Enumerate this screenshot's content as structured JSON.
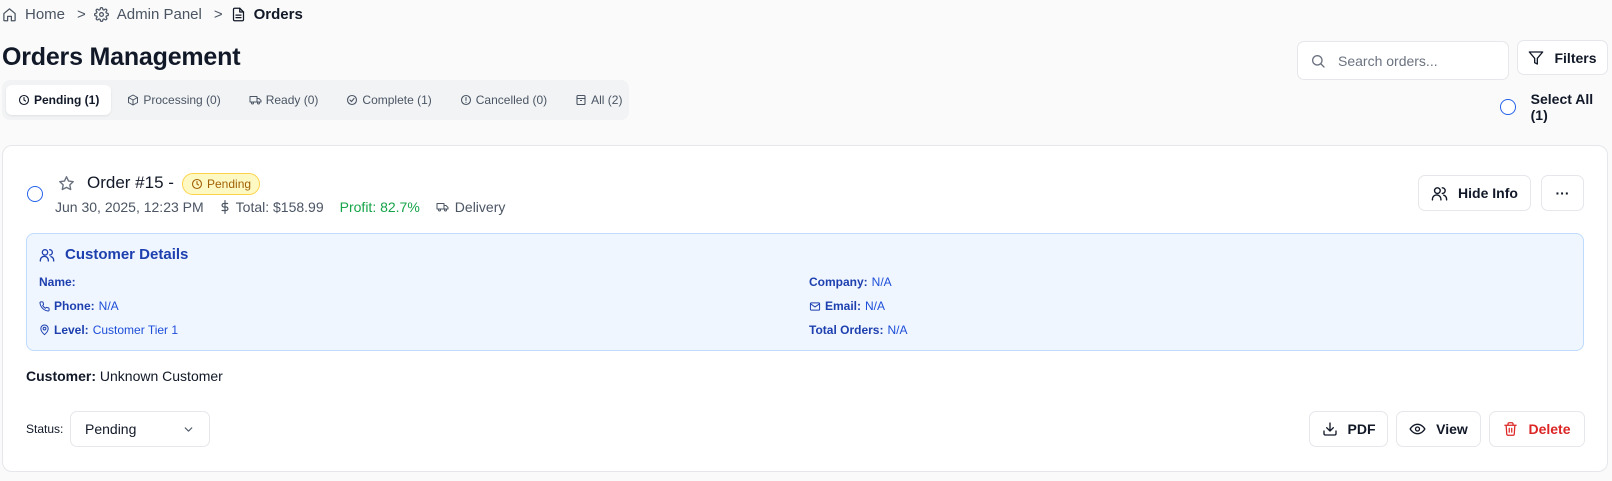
{
  "breadcrumb": {
    "items": [
      {
        "label": "Home",
        "icon": "home-icon"
      },
      {
        "label": "Admin Panel",
        "icon": "gear-icon"
      },
      {
        "label": "Orders",
        "icon": "document-icon"
      }
    ],
    "separator": ">"
  },
  "page": {
    "title": "Orders Management"
  },
  "search": {
    "placeholder": "Search orders..."
  },
  "filters": {
    "label": "Filters"
  },
  "tabs": [
    {
      "label": "Pending (1)",
      "icon": "clock-icon",
      "active": true
    },
    {
      "label": "Processing (0)",
      "icon": "package-icon",
      "active": false
    },
    {
      "label": "Ready (0)",
      "icon": "truck-icon",
      "active": false
    },
    {
      "label": "Complete (1)",
      "icon": "check-circle-icon",
      "active": false
    },
    {
      "label": "Cancelled (0)",
      "icon": "alert-circle-icon",
      "active": false
    },
    {
      "label": "All (2)",
      "icon": "archive-icon",
      "active": false
    }
  ],
  "select_all": {
    "label": "Select All (1)"
  },
  "order": {
    "title": "Order #15 -",
    "status_badge": "Pending",
    "date": "Jun 30, 2025, 12:23 PM",
    "total": "Total: $158.99",
    "profit": "Profit: 82.7%",
    "delivery": "Delivery",
    "hide_info_label": "Hide Info",
    "more_label": "···",
    "customer_details": {
      "title": "Customer Details",
      "name_label": "Name:",
      "name_value": "",
      "phone_label": "Phone:",
      "phone_value": "N/A",
      "level_label": "Level:",
      "level_value": "Customer Tier 1",
      "company_label": "Company:",
      "company_value": "N/A",
      "email_label": "Email:",
      "email_value": "N/A",
      "total_orders_label": "Total Orders:",
      "total_orders_value": "N/A"
    },
    "customer_label": "Customer:",
    "customer_value": "Unknown Customer",
    "status_label": "Status:",
    "status_value": "Pending",
    "actions": {
      "pdf": "PDF",
      "view": "View",
      "delete": "Delete"
    }
  },
  "colors": {
    "accent": "#2563eb",
    "profit": "#16a34a",
    "pending_badge_bg": "#fef9c3",
    "pending_badge_text": "#a16207",
    "details_bg": "#eff6ff",
    "details_text": "#1e40af",
    "delete": "#dc2626"
  }
}
